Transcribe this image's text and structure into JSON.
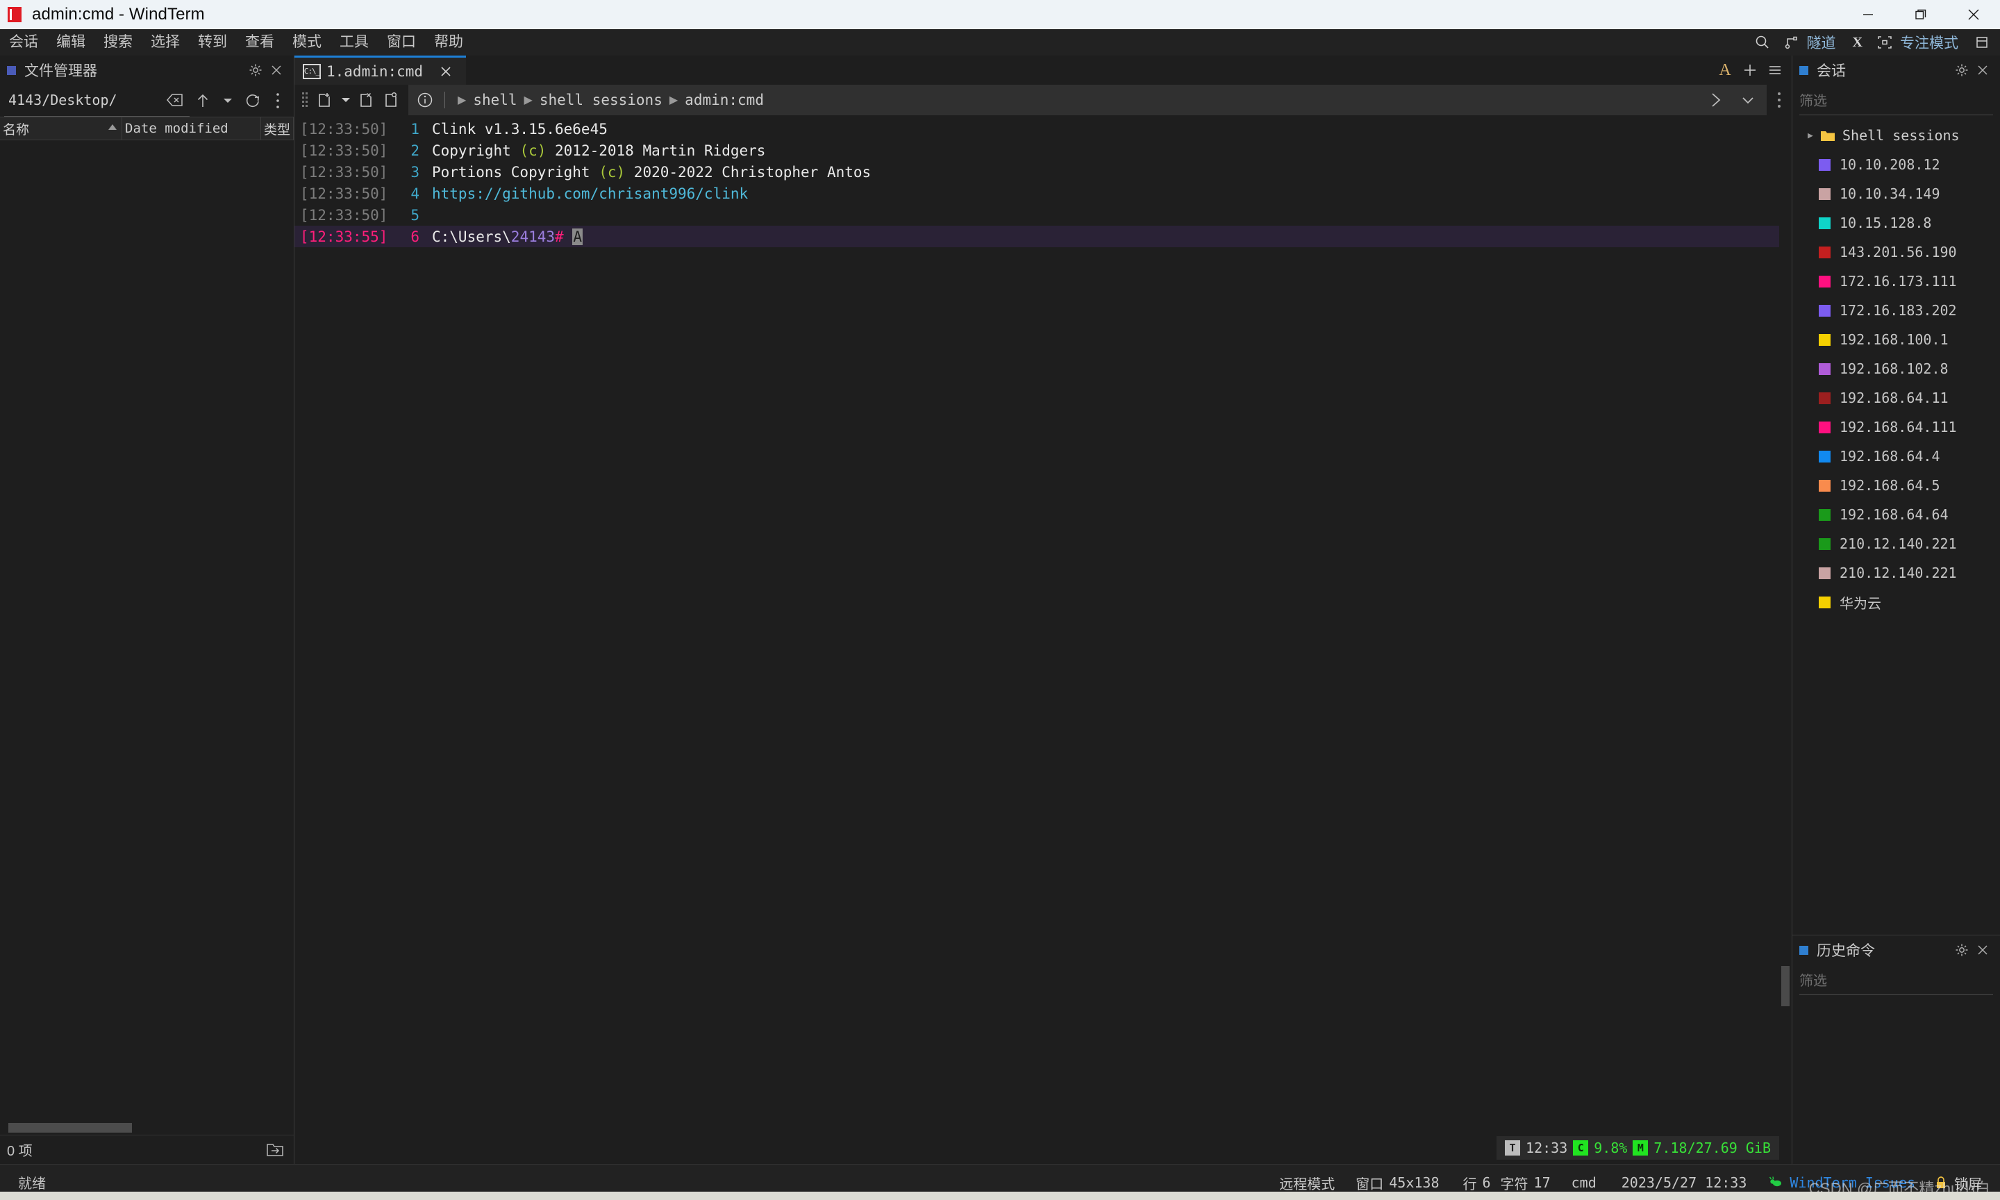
{
  "titlebar": {
    "title": "admin:cmd - WindTerm",
    "minimize_label": "minimize",
    "maximize_label": "restore",
    "close_label": "close"
  },
  "menubar": {
    "items": [
      {
        "label": "会话"
      },
      {
        "label": "编辑"
      },
      {
        "label": "搜索"
      },
      {
        "label": "选择"
      },
      {
        "label": "转到"
      },
      {
        "label": "查看"
      },
      {
        "label": "模式"
      },
      {
        "label": "工具"
      },
      {
        "label": "窗口"
      },
      {
        "label": "帮助"
      }
    ],
    "right": {
      "search_icon": "search-icon",
      "tunnel_icon": "tunnel-icon",
      "tunnel_label": "隧道",
      "x_label": "X",
      "focus_icon": "focus-brackets-icon",
      "focus_label": "专注模式",
      "layout_icon": "layout-icon"
    }
  },
  "filemanager": {
    "panel_title": "文件管理器",
    "settings_icon": "gear-icon",
    "close_icon": "close-icon",
    "path_value": "4143/Desktop/",
    "clear_icon": "backspace-icon",
    "up_icon": "arrow-up-icon",
    "dropdown_icon": "chevron-down-icon",
    "refresh_icon": "refresh-icon",
    "more_icon": "more-vertical-icon",
    "columns": [
      {
        "label": "名称",
        "sort": "ascending"
      },
      {
        "label": "Date modified"
      },
      {
        "label": "类型"
      }
    ],
    "rows": [],
    "footer_count": "0 项",
    "footer_icon": "open-folder-arrow-icon"
  },
  "terminal": {
    "tab": {
      "icon": "cmd-icon",
      "label": "1.admin:cmd",
      "close_icon": "close-icon"
    },
    "tabbar_right": {
      "font_icon": "A",
      "add_icon": "plus-icon",
      "menu_icon": "hamburger-icon"
    },
    "toolbar": {
      "grip_icon": "drag-grip-icon",
      "new_tab_icon": "new-session-icon",
      "new_tab_dropdown_icon": "chevron-down-icon",
      "close_session_icon": "close-session-icon",
      "reconnect_icon": "reconnect-session-icon",
      "info_icon": "info-circle-icon",
      "send_icon": "chevron-right-icon",
      "expand_icon": "chevron-down-icon",
      "more_icon": "more-vertical-icon"
    },
    "breadcrumb": [
      "shell",
      "shell sessions",
      "admin:cmd"
    ],
    "lines": [
      {
        "timestamp": "[12:33:50]",
        "number": "1",
        "current": false,
        "segments": [
          {
            "text": "Clink v1.3.15.6e6e45",
            "color": "white"
          }
        ]
      },
      {
        "timestamp": "[12:33:50]",
        "number": "2",
        "current": false,
        "segments": [
          {
            "text": "Copyright ",
            "color": "white"
          },
          {
            "text": "(c)",
            "color": "green"
          },
          {
            "text": " 2012-2018 Martin Ridgers",
            "color": "white"
          }
        ]
      },
      {
        "timestamp": "[12:33:50]",
        "number": "3",
        "current": false,
        "segments": [
          {
            "text": "Portions Copyright ",
            "color": "white"
          },
          {
            "text": "(c)",
            "color": "green"
          },
          {
            "text": " 2020-2022 Christopher Antos",
            "color": "white"
          }
        ]
      },
      {
        "timestamp": "[12:33:50]",
        "number": "4",
        "current": false,
        "segments": [
          {
            "text": "https://github.com/chrisant996/clink",
            "color": "cyan"
          }
        ]
      },
      {
        "timestamp": "[12:33:50]",
        "number": "5",
        "current": false,
        "segments": []
      },
      {
        "timestamp": "[12:33:55]",
        "number": "6",
        "current": true,
        "segments": [
          {
            "text": "C:\\Users\\",
            "color": "white"
          },
          {
            "text": "24143",
            "color": "purple"
          },
          {
            "text": "#",
            "color": "pink"
          },
          {
            "text": " ",
            "color": "white"
          },
          {
            "text": "A",
            "color": "cursor"
          }
        ]
      }
    ],
    "sysmon": {
      "time_badge": "T",
      "time": "12:33",
      "cpu_badge": "C",
      "cpu": "9.8%",
      "mem_badge": "M",
      "mem": "7.18/27.69 GiB"
    }
  },
  "sessions": {
    "panel_title": "会话",
    "settings_icon": "gear-icon",
    "close_icon": "close-icon",
    "filter_placeholder": "筛选",
    "items": [
      {
        "label": "Shell sessions",
        "type": "folder",
        "color": "#f5c542",
        "expandable": true
      },
      {
        "label": "10.10.208.12",
        "type": "session",
        "color": "#7c5cf0"
      },
      {
        "label": "10.10.34.149",
        "type": "session",
        "color": "#c9a3a3"
      },
      {
        "label": "10.15.128.8",
        "type": "session",
        "color": "#0fd4c8"
      },
      {
        "label": "143.201.56.190",
        "type": "session",
        "color": "#c41f1f"
      },
      {
        "label": "172.16.173.111",
        "type": "session",
        "color": "#ff1080"
      },
      {
        "label": "172.16.183.202",
        "type": "session",
        "color": "#7c5cf0"
      },
      {
        "label": "192.168.100.1",
        "type": "session",
        "color": "#f5d000"
      },
      {
        "label": "192.168.102.8",
        "type": "session",
        "color": "#b05cd8"
      },
      {
        "label": "192.168.64.11",
        "type": "session",
        "color": "#9c1f1f"
      },
      {
        "label": "192.168.64.111",
        "type": "session",
        "color": "#ff1080"
      },
      {
        "label": "192.168.64.4",
        "type": "session",
        "color": "#1189f0"
      },
      {
        "label": "192.168.64.5",
        "type": "session",
        "color": "#f98b4d"
      },
      {
        "label": "192.168.64.64",
        "type": "session",
        "color": "#1a9a1a"
      },
      {
        "label": "210.12.140.221",
        "type": "session",
        "color": "#1a9a1a"
      },
      {
        "label": "210.12.140.221",
        "type": "session",
        "color": "#c9a3a3"
      },
      {
        "label": "华为云",
        "type": "session",
        "color": "#f5d000"
      }
    ]
  },
  "history": {
    "panel_title": "历史命令",
    "settings_icon": "gear-icon",
    "close_icon": "close-icon",
    "filter_placeholder": "筛选",
    "items": []
  },
  "statusbar": {
    "ready": "就绪",
    "mode": "远程模式",
    "window_label": "窗口",
    "window_size": "45x138",
    "row_label": "行",
    "row_value": "6",
    "char_label": "字符",
    "char_value": "17",
    "shell": "cmd",
    "datetime": "2023/5/27 12:33",
    "issues_icon": "bug-icon",
    "issues_label": "WindTerm Issues",
    "lock_icon": "lock-icon",
    "lock_label": "锁屏"
  },
  "watermark": "CSDN @广而不精zhu小白"
}
